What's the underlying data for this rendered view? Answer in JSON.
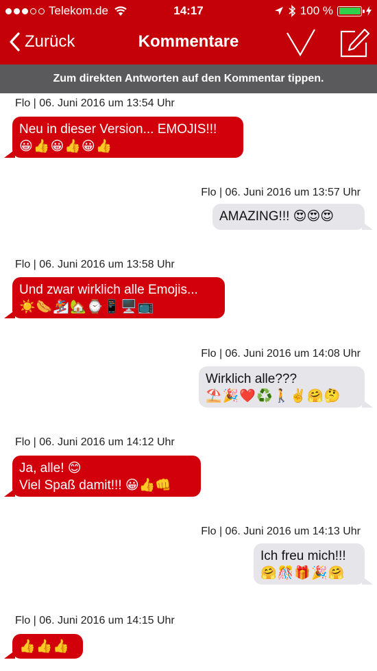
{
  "status_bar": {
    "carrier": "Telekom.de",
    "time": "14:17",
    "battery_percent": "100 %",
    "battery_level": 1.0,
    "signal_bars_filled": 3,
    "signal_bars_total": 5,
    "colors": {
      "battery_fill": "#2fd04a"
    }
  },
  "navbar": {
    "back_label": "Zurück",
    "title": "Kommentare",
    "accent": "#c40008"
  },
  "hint": {
    "text": "Zum direkten Antworten auf den Kommentar tippen."
  },
  "messages": [
    {
      "meta": "Flo | 06. Juni 2016 um 13:54 Uhr",
      "side": "left",
      "lines": [
        "Neu in dieser Version... EMOJIS!!!",
        "😀👍😀👍😀👍"
      ]
    },
    {
      "meta": "Flo | 06. Juni 2016 um 13:57 Uhr",
      "side": "right",
      "lines": [
        "AMAZING!!! 😍😍😍"
      ]
    },
    {
      "meta": "Flo | 06. Juni 2016 um 13:58 Uhr",
      "side": "left",
      "lines": [
        "Und zwar wirklich alle Emojis...",
        "☀️🌭🏂🏡⌚📱🖥️📺"
      ]
    },
    {
      "meta": "Flo | 06. Juni 2016 um 14:08 Uhr",
      "side": "right",
      "lines": [
        "Wirklich alle???",
        "⛱️🎉❤️♻️🚶✌️🤗🤔"
      ]
    },
    {
      "meta": "Flo | 06. Juni 2016 um 14:12 Uhr",
      "side": "left",
      "lines": [
        "Ja, alle! 😊",
        "Viel Spaß damit!!! 😀👍👊"
      ]
    },
    {
      "meta": "Flo | 06. Juni 2016 um 14:13 Uhr",
      "side": "right",
      "lines": [
        "Ich freu mich!!!",
        "🤗🎊🎁🎉🤗"
      ]
    },
    {
      "meta": "Flo | 06. Juni 2016 um 14:15 Uhr",
      "side": "left",
      "lines": [
        "👍👍👍"
      ]
    }
  ]
}
